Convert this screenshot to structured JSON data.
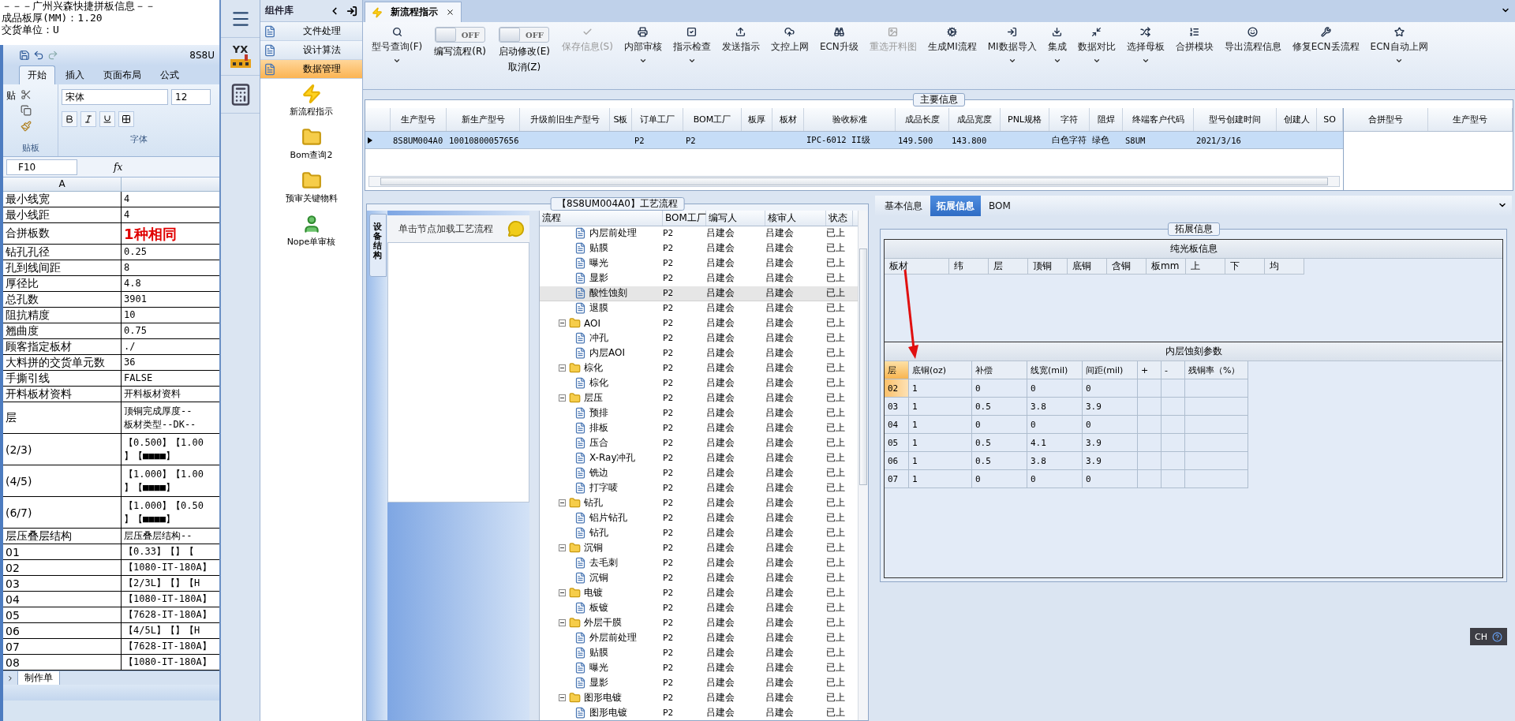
{
  "excel": {
    "top_lines": [
      "－－－广州兴森快捷拼板信息－－",
      "成品板厚(MM)：1.20",
      "交货单位：U"
    ],
    "title": "8S8U",
    "tabs": [
      {
        "label": "开始",
        "selected": true
      },
      {
        "label": "插入",
        "selected": false
      },
      {
        "label": "页面布局",
        "selected": false
      },
      {
        "label": "公式",
        "selected": false
      }
    ],
    "paste_label": "贴",
    "font": "宋体",
    "size": "12",
    "group_labels": [
      "贴板",
      "字体"
    ],
    "name_box": "F10",
    "formula_label": "fx",
    "column": "A",
    "rows": [
      {
        "kind": "text",
        "label": "最小线宽",
        "values": [
          "4"
        ]
      },
      {
        "kind": "text",
        "label": "最小线距",
        "values": [
          "4"
        ]
      },
      {
        "kind": "emphasis",
        "label": "合拼板数",
        "values": [
          "1种相同"
        ]
      },
      {
        "kind": "text",
        "label": "钻孔孔径",
        "values": [
          "0.25"
        ]
      },
      {
        "kind": "text",
        "label": "孔到线间距",
        "values": [
          "8"
        ]
      },
      {
        "kind": "text",
        "label": "厚径比",
        "values": [
          "4.8"
        ]
      },
      {
        "kind": "text",
        "label": "总孔数",
        "values": [
          "3901"
        ]
      },
      {
        "kind": "text",
        "label": "阻抗精度",
        "values": [
          "10"
        ]
      },
      {
        "kind": "text",
        "label": "翘曲度",
        "values": [
          "0.75"
        ]
      },
      {
        "kind": "text",
        "label": "顾客指定板材",
        "values": [
          "./"
        ]
      },
      {
        "kind": "text",
        "label": "大料拼的交货单元数",
        "values": [
          "36"
        ]
      },
      {
        "kind": "text",
        "label": "手撕引线",
        "values": [
          "FALSE"
        ]
      },
      {
        "kind": "text",
        "label": "开料板材资料",
        "values": [
          "开料板材资料"
        ]
      },
      {
        "kind": "text",
        "label": "层",
        "values": [
          "顶铜完成厚度--",
          "板材类型--DK--"
        ]
      },
      {
        "kind": "text",
        "label": "(2/3)",
        "values": [
          "【0.500】【1.00",
          "】【■■■■】"
        ]
      },
      {
        "kind": "text",
        "label": "(4/5)",
        "values": [
          "【1.000】【1.00",
          "】【■■■■】"
        ]
      },
      {
        "kind": "text",
        "label": "(6/7)",
        "values": [
          "【1.000】【0.50",
          "】【■■■■】"
        ]
      },
      {
        "kind": "text",
        "label": "层压叠层结构",
        "values": [
          "层压叠层结构--"
        ]
      },
      {
        "kind": "text",
        "label": "01",
        "values": [
          "【0.33】【】【"
        ]
      },
      {
        "kind": "text",
        "label": "02",
        "values": [
          "【1080-IT-180A】"
        ]
      },
      {
        "kind": "text",
        "label": "03",
        "values": [
          "【2/3L】【】【H"
        ]
      },
      {
        "kind": "text",
        "label": "04",
        "values": [
          "【1080-IT-180A】"
        ]
      },
      {
        "kind": "text",
        "label": "05",
        "values": [
          "【7628-IT-180A】"
        ]
      },
      {
        "kind": "text",
        "label": "06",
        "values": [
          "【4/5L】【】【H"
        ]
      },
      {
        "kind": "text",
        "label": "07",
        "values": [
          "【7628-IT-180A】"
        ]
      },
      {
        "kind": "text",
        "label": "08",
        "values": [
          "【1080-IT-180A】"
        ]
      }
    ],
    "sheet_tab": "制作单"
  },
  "sidebar": {
    "logo_text": "YX"
  },
  "components": {
    "title": "组件库",
    "items": [
      {
        "label": "文件处理",
        "selected": false
      },
      {
        "label": "设计算法",
        "selected": false
      },
      {
        "label": "数据管理",
        "selected": true
      }
    ],
    "tools": [
      {
        "label": "新流程指示"
      },
      {
        "label": "Bom查询2"
      },
      {
        "label": "预审关键物料"
      },
      {
        "label": "Nope单审核"
      }
    ]
  },
  "main_tabs": [
    {
      "label": "新流程指示",
      "selected": true
    }
  ],
  "toolbar": {
    "items": [
      {
        "kind": "button",
        "label": "型号查询(F)",
        "disabled": false,
        "dropdown": true
      },
      {
        "kind": "toggle",
        "labels": [
          "编写流程(R)"
        ],
        "state": "OFF",
        "on": false
      },
      {
        "kind": "toggle",
        "labels": [
          "启动修改(E)",
          "取消(Z)"
        ],
        "state": "OFF",
        "on": false
      },
      {
        "kind": "button",
        "label": "保存信息(S)",
        "disabled": true,
        "dropdown": false
      },
      {
        "kind": "button",
        "label": "内部审核",
        "disabled": false,
        "dropdown": true
      },
      {
        "kind": "button",
        "label": "指示检查",
        "disabled": false,
        "dropdown": true
      },
      {
        "kind": "button",
        "label": "发送指示",
        "disabled": false,
        "dropdown": false
      },
      {
        "kind": "button",
        "label": "文控上网",
        "disabled": false,
        "dropdown": false
      },
      {
        "kind": "button",
        "label": "ECN升级",
        "disabled": false,
        "dropdown": false
      },
      {
        "kind": "button",
        "label": "重选开料图",
        "disabled": true,
        "dropdown": false
      },
      {
        "kind": "button",
        "label": "生成MI流程",
        "disabled": false,
        "dropdown": false
      },
      {
        "kind": "button",
        "label": "MI数据导入",
        "disabled": false,
        "dropdown": true
      },
      {
        "kind": "button",
        "label": "集成",
        "disabled": false,
        "dropdown": true
      },
      {
        "kind": "button",
        "label": "数据对比",
        "disabled": false,
        "dropdown": true
      },
      {
        "kind": "button",
        "label": "选择母板",
        "disabled": false,
        "dropdown": true
      },
      {
        "kind": "button",
        "label": "合拼模块",
        "disabled": false,
        "dropdown": false
      },
      {
        "kind": "button",
        "label": "导出流程信息",
        "disabled": false,
        "dropdown": false
      },
      {
        "kind": "button",
        "label": "修复ECN丢流程",
        "disabled": false,
        "dropdown": false
      },
      {
        "kind": "button",
        "label": "ECN自动上网",
        "disabled": false,
        "dropdown": true
      }
    ]
  },
  "main_info": {
    "title": "主要信息",
    "columns": [
      "生产型号",
      "新生产型号",
      "升级前旧生产型号",
      "S板",
      "订单工厂",
      "BOM工厂",
      "板厚",
      "板材",
      "验收标准",
      "成品长度",
      "成品宽度",
      "PNL规格",
      "字符",
      "阻焊",
      "终端客户代码",
      "型号创建时间",
      "创建人",
      "SO"
    ],
    "rows": [
      {
        "selected": true,
        "cells": [
          "8S8UM004A0",
          "10010800057656",
          null,
          null,
          "P2",
          "P2",
          null,
          null,
          "IPC-6012 II级",
          "149.500",
          "143.800",
          null,
          "白色字符",
          "绿色",
          "S8UM",
          "2021/3/16",
          null,
          null
        ]
      }
    ],
    "side_columns": [
      "合拼型号",
      "生产型号"
    ]
  },
  "process": {
    "title": "【8S8UM004A0】工艺流程",
    "side_tab": "设备结构",
    "hint": "单击节点加载工艺流程",
    "columns": [
      "流程",
      "BOM工厂",
      "编写人",
      "核审人",
      "状态"
    ],
    "rows": [
      {
        "kind": "step",
        "name": "内层前处理",
        "bom": "P2",
        "writer": "吕建会",
        "reviewer": "吕建会",
        "status": "已上",
        "selected": false
      },
      {
        "kind": "step",
        "name": "贴膜",
        "bom": "P2",
        "writer": "吕建会",
        "reviewer": "吕建会",
        "status": "已上",
        "selected": false
      },
      {
        "kind": "step",
        "name": "曝光",
        "bom": "P2",
        "writer": "吕建会",
        "reviewer": "吕建会",
        "status": "已上",
        "selected": false
      },
      {
        "kind": "step",
        "name": "显影",
        "bom": "P2",
        "writer": "吕建会",
        "reviewer": "吕建会",
        "status": "已上",
        "selected": false
      },
      {
        "kind": "step",
        "name": "酸性蚀刻",
        "bom": "P2",
        "writer": "吕建会",
        "reviewer": "吕建会",
        "status": "已上",
        "selected": true
      },
      {
        "kind": "step",
        "name": "退膜",
        "bom": "P2",
        "writer": "吕建会",
        "reviewer": "吕建会",
        "status": "已上",
        "selected": false
      },
      {
        "kind": "folder",
        "name": "AOI",
        "bom": "P2",
        "writer": "吕建会",
        "reviewer": "吕建会",
        "status": "已上",
        "selected": false,
        "expanded": true,
        "children": [
          {
            "kind": "step",
            "name": "冲孔",
            "bom": "P2",
            "writer": "吕建会",
            "reviewer": "吕建会",
            "status": "已上",
            "selected": false
          },
          {
            "kind": "step",
            "name": "内层AOI",
            "bom": "P2",
            "writer": "吕建会",
            "reviewer": "吕建会",
            "status": "已上",
            "selected": false
          }
        ]
      },
      {
        "kind": "folder",
        "name": "棕化",
        "bom": "P2",
        "writer": "吕建会",
        "reviewer": "吕建会",
        "status": "已上",
        "selected": false,
        "expanded": true,
        "children": [
          {
            "kind": "step",
            "name": "棕化",
            "bom": "P2",
            "writer": "吕建会",
            "reviewer": "吕建会",
            "status": "已上",
            "selected": false
          }
        ]
      },
      {
        "kind": "folder",
        "name": "层压",
        "bom": "P2",
        "writer": "吕建会",
        "reviewer": "吕建会",
        "status": "已上",
        "selected": false,
        "expanded": true,
        "children": [
          {
            "kind": "step",
            "name": "预排",
            "bom": "P2",
            "writer": "吕建会",
            "reviewer": "吕建会",
            "status": "已上",
            "selected": false
          },
          {
            "kind": "step",
            "name": "排板",
            "bom": "P2",
            "writer": "吕建会",
            "reviewer": "吕建会",
            "status": "已上",
            "selected": false
          },
          {
            "kind": "step",
            "name": "压合",
            "bom": "P2",
            "writer": "吕建会",
            "reviewer": "吕建会",
            "status": "已上",
            "selected": false
          },
          {
            "kind": "step",
            "name": "X-Ray冲孔",
            "bom": "P2",
            "writer": "吕建会",
            "reviewer": "吕建会",
            "status": "已上",
            "selected": false
          },
          {
            "kind": "step",
            "name": "铣边",
            "bom": "P2",
            "writer": "吕建会",
            "reviewer": "吕建会",
            "status": "已上",
            "selected": false
          },
          {
            "kind": "step",
            "name": "打字唛",
            "bom": "P2",
            "writer": "吕建会",
            "reviewer": "吕建会",
            "status": "已上",
            "selected": false
          }
        ]
      },
      {
        "kind": "folder",
        "name": "钻孔",
        "bom": "P2",
        "writer": "吕建会",
        "reviewer": "吕建会",
        "status": "已上",
        "selected": false,
        "expanded": true,
        "children": [
          {
            "kind": "step",
            "name": "铝片钻孔",
            "bom": "P2",
            "writer": "吕建会",
            "reviewer": "吕建会",
            "status": "已上",
            "selected": false
          },
          {
            "kind": "step",
            "name": "钻孔",
            "bom": "P2",
            "writer": "吕建会",
            "reviewer": "吕建会",
            "status": "已上",
            "selected": false
          }
        ]
      },
      {
        "kind": "folder",
        "name": "沉铜",
        "bom": "P2",
        "writer": "吕建会",
        "reviewer": "吕建会",
        "status": "已上",
        "selected": false,
        "expanded": true,
        "children": [
          {
            "kind": "step",
            "name": "去毛刺",
            "bom": "P2",
            "writer": "吕建会",
            "reviewer": "吕建会",
            "status": "已上",
            "selected": false
          },
          {
            "kind": "step",
            "name": "沉铜",
            "bom": "P2",
            "writer": "吕建会",
            "reviewer": "吕建会",
            "status": "已上",
            "selected": false
          }
        ]
      },
      {
        "kind": "folder",
        "name": "电镀",
        "bom": "P2",
        "writer": "吕建会",
        "reviewer": "吕建会",
        "status": "已上",
        "selected": false,
        "expanded": true,
        "children": [
          {
            "kind": "step",
            "name": "板镀",
            "bom": "P2",
            "writer": "吕建会",
            "reviewer": "吕建会",
            "status": "已上",
            "selected": false
          }
        ]
      },
      {
        "kind": "folder",
        "name": "外层干膜",
        "bom": "P2",
        "writer": "吕建会",
        "reviewer": "吕建会",
        "status": "已上",
        "selected": false,
        "expanded": true,
        "children": [
          {
            "kind": "step",
            "name": "外层前处理",
            "bom": "P2",
            "writer": "吕建会",
            "reviewer": "吕建会",
            "status": "已上",
            "selected": false
          },
          {
            "kind": "step",
            "name": "贴膜",
            "bom": "P2",
            "writer": "吕建会",
            "reviewer": "吕建会",
            "status": "已上",
            "selected": false
          },
          {
            "kind": "step",
            "name": "曝光",
            "bom": "P2",
            "writer": "吕建会",
            "reviewer": "吕建会",
            "status": "已上",
            "selected": false
          },
          {
            "kind": "step",
            "name": "显影",
            "bom": "P2",
            "writer": "吕建会",
            "reviewer": "吕建会",
            "status": "已上",
            "selected": false
          }
        ]
      },
      {
        "kind": "folder",
        "name": "图形电镀",
        "bom": "P2",
        "writer": "吕建会",
        "reviewer": "吕建会",
        "status": "已上",
        "selected": false,
        "expanded": true,
        "children": [
          {
            "kind": "step",
            "name": "图形电镀",
            "bom": "P2",
            "writer": "吕建会",
            "reviewer": "吕建会",
            "status": "已上",
            "selected": false
          }
        ]
      }
    ]
  },
  "details": {
    "tabs": [
      {
        "label": "基本信息",
        "selected": false
      },
      {
        "label": "拓展信息",
        "selected": true
      },
      {
        "label": "BOM",
        "selected": false
      }
    ],
    "group_title": "拓展信息",
    "plain_board": {
      "title": "纯光板信息",
      "columns": [
        "板材",
        "纬",
        "层",
        "顶铜",
        "底铜",
        "含铜",
        "板mm",
        "上",
        "下",
        "均"
      ]
    },
    "etch": {
      "title": "内层蚀刻参数",
      "columns": [
        "层",
        "底铜(oz)",
        "补偿",
        "线宽(mil)",
        "间距(mil)",
        "+",
        "-",
        "残铜率（%）"
      ],
      "rows": [
        {
          "selected": true,
          "cells": [
            "02",
            "1",
            "0",
            "0",
            "0",
            null,
            null,
            null
          ]
        },
        {
          "selected": false,
          "cells": [
            "03",
            "1",
            "0.5",
            "3.8",
            "3.9",
            null,
            null,
            null
          ]
        },
        {
          "selected": false,
          "cells": [
            "04",
            "1",
            "0",
            "0",
            "0",
            null,
            null,
            null
          ]
        },
        {
          "selected": false,
          "cells": [
            "05",
            "1",
            "0.5",
            "4.1",
            "3.9",
            null,
            null,
            null
          ]
        },
        {
          "selected": false,
          "cells": [
            "06",
            "1",
            "0.5",
            "3.8",
            "3.9",
            null,
            null,
            null
          ]
        },
        {
          "selected": false,
          "cells": [
            "07",
            "1",
            "0",
            "0",
            "0",
            null,
            null,
            null
          ]
        }
      ]
    }
  },
  "language_bar": {
    "label": "CH"
  }
}
